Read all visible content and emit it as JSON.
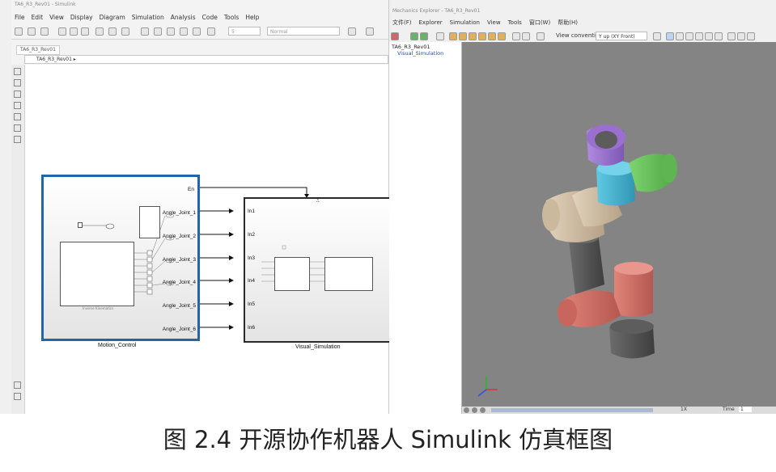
{
  "simulink": {
    "title": "TA6_R3_Rev01 - Simulink",
    "menu": [
      "File",
      "Edit",
      "View",
      "Display",
      "Diagram",
      "Simulation",
      "Analysis",
      "Code",
      "Tools",
      "Help"
    ],
    "sim_time": "5",
    "sim_mode": "Normal",
    "tab": "TA6_R3_Rev01",
    "address": "TA6_R3_Rev01 ▸",
    "blocks": {
      "motion_control": {
        "label": "Motion_Control",
        "en_port": "En",
        "outports": [
          "Angle_Joint_1",
          "Angle_Joint_2",
          "Angle_Joint_3",
          "Angle_Joint_4",
          "Angle_Joint_5",
          "Angle_Joint_6"
        ],
        "inner_caption": "Inverse Kinematics"
      },
      "visual_simulation": {
        "label": "Visual_Simulation",
        "inports": [
          "In1",
          "In2",
          "In3",
          "In4",
          "In5",
          "In6"
        ]
      }
    }
  },
  "mechanics_explorer": {
    "title": "Mechanics Explorer - TA6_R3_Rev01",
    "menu": [
      "文件(F)",
      "Explorer",
      "Simulation",
      "View",
      "Tools",
      "窗口(W)",
      "帮助(H)"
    ],
    "view_convention_label": "View convention",
    "view_convention_value": "Y up (XY Front)",
    "tree": [
      "TA6_R3_Rev01",
      "Visual_Simulation"
    ],
    "time_label": "Time",
    "time_value": "1",
    "speed": "1X"
  },
  "colors": {
    "viewport_bg": "#848484",
    "link_purple": "#9a6fcf",
    "link_green": "#6cc25e",
    "link_cyan": "#49b5d2",
    "link_tan": "#cdbba2",
    "link_gray": "#5a5a5a",
    "link_red": "#d06a62",
    "selection_blue": "#2166a6"
  },
  "caption": "图 2.4 开源协作机器人 Simulink 仿真框图"
}
